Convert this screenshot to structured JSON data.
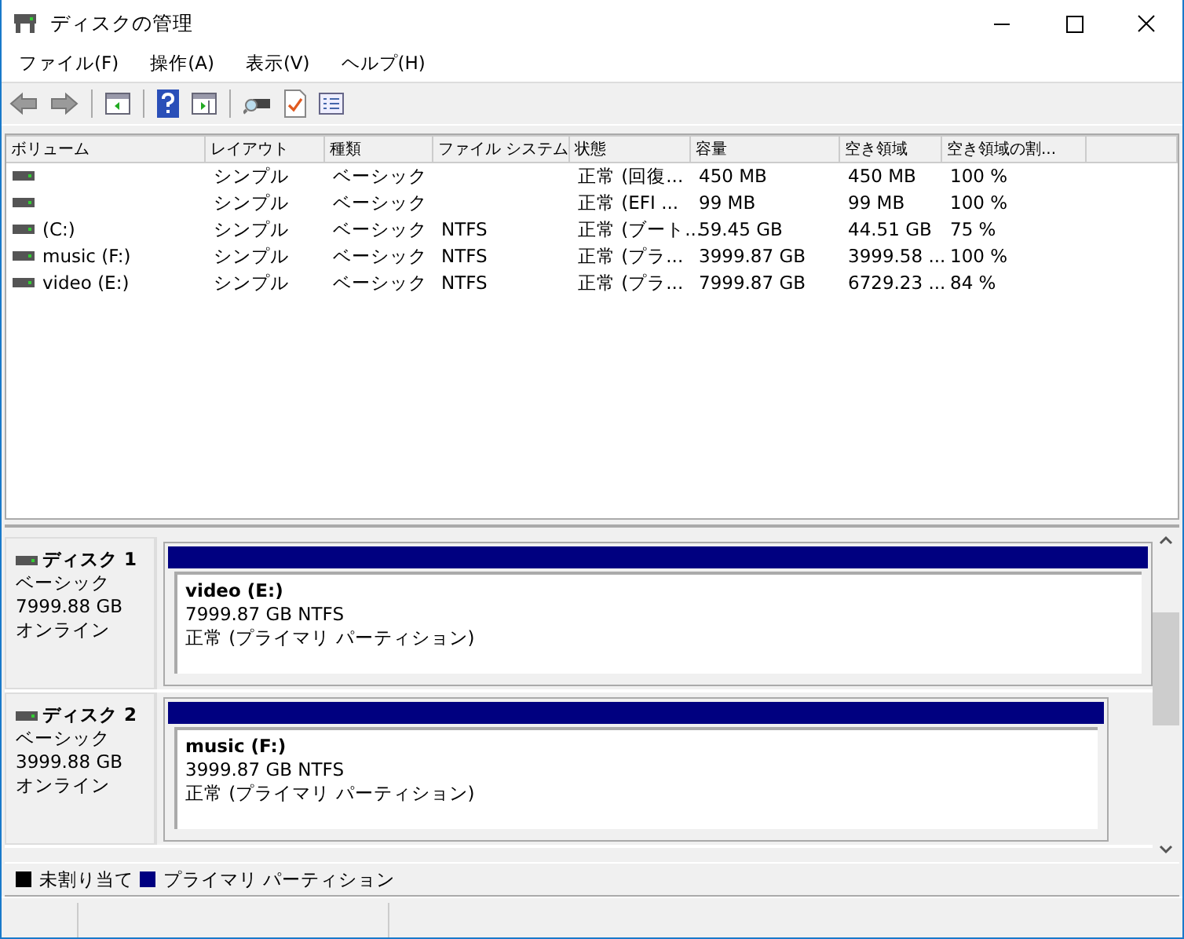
{
  "window": {
    "title": "ディスクの管理"
  },
  "menu": [
    "ファイル(F)",
    "操作(A)",
    "表示(V)",
    "ヘルプ(H)"
  ],
  "volume_table": {
    "columns": [
      "ボリューム",
      "レイアウト",
      "種類",
      "ファイル システム",
      "状態",
      "容量",
      "空き領域",
      "空き領域の割..."
    ],
    "rows": [
      [
        "",
        "シンプル",
        "ベーシック",
        "",
        "正常 (回復...",
        "450 MB",
        "450 MB",
        "100 %"
      ],
      [
        "",
        "シンプル",
        "ベーシック",
        "",
        "正常 (EFI ...",
        "99 MB",
        "99 MB",
        "100 %"
      ],
      [
        "(C:)",
        "シンプル",
        "ベーシック",
        "NTFS",
        "正常 (ブート...",
        "59.45 GB",
        "44.51 GB",
        "75 %"
      ],
      [
        "music (F:)",
        "シンプル",
        "ベーシック",
        "NTFS",
        "正常 (プラ...",
        "3999.87 GB",
        "3999.58 ...",
        "100 %"
      ],
      [
        "video (E:)",
        "シンプル",
        "ベーシック",
        "NTFS",
        "正常 (プラ...",
        "7999.87 GB",
        "6729.23 ...",
        "84 %"
      ]
    ]
  },
  "disks": [
    {
      "name": "ディスク 1",
      "type": "ベーシック",
      "size": "7999.88 GB",
      "status": "オンライン",
      "partition": {
        "label": "video  (E:)",
        "size": "7999.87 GB NTFS",
        "status": "正常 (プライマリ パーティション)",
        "color": "#000080",
        "level": 1
      }
    },
    {
      "name": "ディスク 2",
      "type": "ベーシック",
      "size": "3999.88 GB",
      "status": "オンライン",
      "partition": {
        "label": "music  (F:)",
        "size": "3999.87 GB NTFS",
        "status": "正常 (プライマリ パーティション)",
        "color": "#000080",
        "level": 0.955
      }
    }
  ],
  "legend": [
    {
      "label": "未割り当て",
      "color": "#000000"
    },
    {
      "label": "プライマリ パーティション",
      "color": "#000080"
    }
  ]
}
